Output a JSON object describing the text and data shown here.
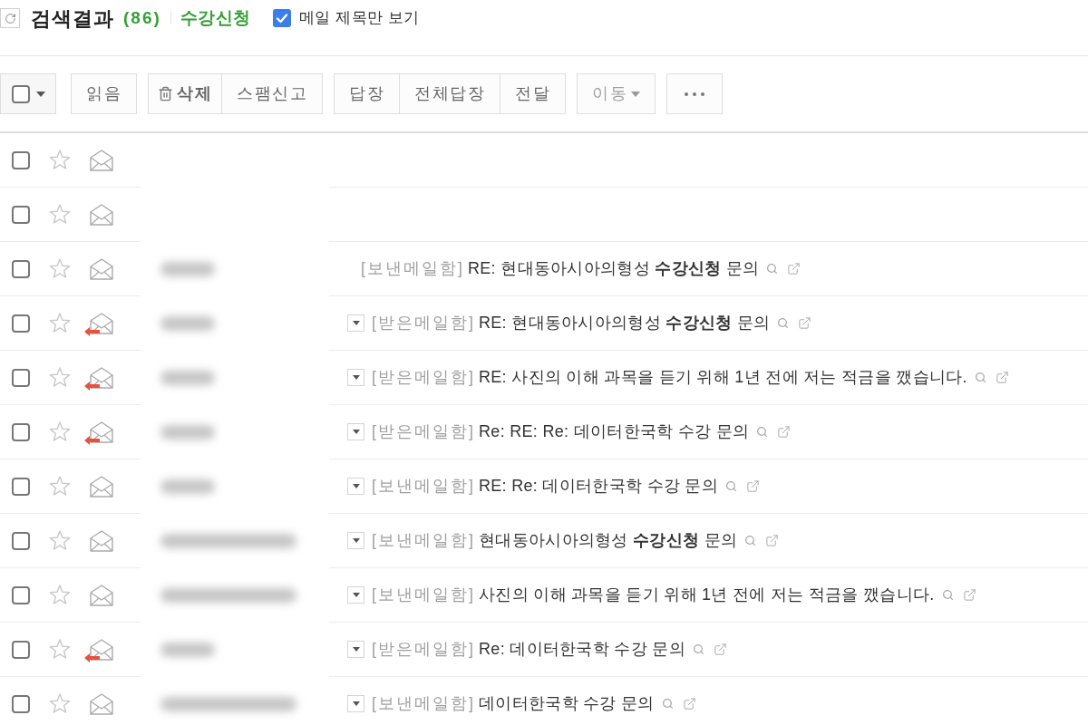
{
  "header": {
    "title": "검색결과",
    "count": "(86)",
    "query": "수강신청",
    "subject_only": {
      "label": "메일 제목만 보기",
      "checked": true
    }
  },
  "toolbar": {
    "select_all": {
      "checked": false
    },
    "groups": [
      [
        {
          "kind": "plain",
          "label": "읽음",
          "disabled": false
        }
      ],
      [
        {
          "kind": "trash",
          "label": "삭제",
          "disabled": false
        },
        {
          "kind": "plain",
          "label": "스팸신고",
          "disabled": false
        }
      ],
      [
        {
          "kind": "plain",
          "label": "답장",
          "disabled": false
        },
        {
          "kind": "plain",
          "label": "전체답장",
          "disabled": false
        },
        {
          "kind": "plain",
          "label": "전달",
          "disabled": false
        }
      ],
      [
        {
          "kind": "dropdown",
          "label": "이동",
          "disabled": true
        }
      ],
      [
        {
          "kind": "more",
          "disabled": false
        }
      ]
    ]
  },
  "rows": [
    {
      "checked": false,
      "starred": false,
      "replied": false
    },
    {
      "checked": false,
      "starred": false,
      "replied": false
    },
    {
      "checked": false,
      "starred": false,
      "replied": false,
      "sender": {
        "kind": "blur_short"
      },
      "expandable": false,
      "folder": "[보낸메일함]",
      "subject": "RE: 현대동아시아의형성 **수강신청** 문의"
    },
    {
      "checked": false,
      "starred": false,
      "replied": true,
      "sender": {
        "kind": "blur_short"
      },
      "expandable": true,
      "folder": "[받은메일함]",
      "subject": "RE: 현대동아시아의형성 **수강신청** 문의"
    },
    {
      "checked": false,
      "starred": false,
      "replied": true,
      "sender": {
        "kind": "blur_short"
      },
      "expandable": true,
      "folder": "[받은메일함]",
      "subject": "RE: 사진의 이해 과목을 듣기 위해 1년 전에 저는 적금을 깼습니다."
    },
    {
      "checked": false,
      "starred": false,
      "replied": true,
      "sender": {
        "kind": "blur_short"
      },
      "expandable": true,
      "folder": "[받은메일함]",
      "subject": "Re: RE: Re: 데이터한국학 수강 문의"
    },
    {
      "checked": false,
      "starred": false,
      "replied": false,
      "sender": {
        "kind": "blur_short"
      },
      "expandable": true,
      "folder": "[보낸메일함]",
      "subject": "RE: Re: 데이터한국학 수강 문의"
    },
    {
      "checked": false,
      "starred": false,
      "replied": false,
      "sender": {
        "kind": "blur_long"
      },
      "expandable": true,
      "folder": "[보낸메일함]",
      "subject": "현대동아시아의형성 **수강신청** 문의"
    },
    {
      "checked": false,
      "starred": false,
      "replied": false,
      "sender": {
        "kind": "blur_long"
      },
      "expandable": true,
      "folder": "[보낸메일함]",
      "subject": "사진의 이해 과목을 듣기 위해 1년 전에 저는 적금을 깼습니다."
    },
    {
      "checked": false,
      "starred": false,
      "replied": true,
      "sender": {
        "kind": "blur_short"
      },
      "expandable": true,
      "folder": "[받은메일함]",
      "subject": "Re: 데이터한국학 수강 문의"
    },
    {
      "checked": false,
      "starred": false,
      "replied": false,
      "sender": {
        "kind": "blur_long"
      },
      "expandable": true,
      "folder": "[보낸메일함]",
      "subject": "데이터한국학 수강 문의"
    }
  ]
}
